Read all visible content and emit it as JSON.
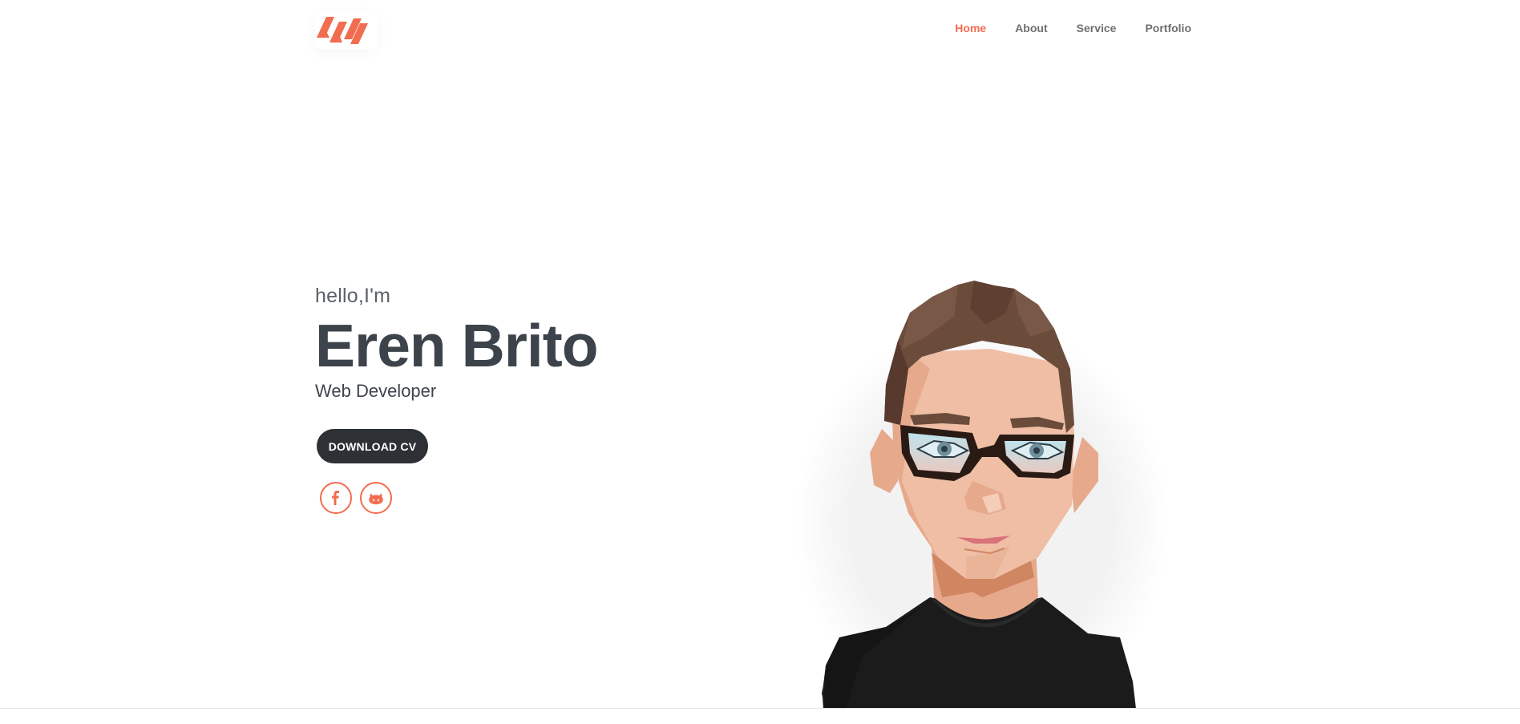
{
  "nav": {
    "items": [
      {
        "label": "Home",
        "active": true
      },
      {
        "label": "About",
        "active": false
      },
      {
        "label": "Service",
        "active": false
      },
      {
        "label": "Portfolio",
        "active": false
      }
    ]
  },
  "hero": {
    "greeting": "hello,I'm",
    "name": "Eren Brito",
    "role": "Web Developer",
    "cv_button": "DOWNLOAD CV"
  },
  "social": {
    "items": [
      {
        "icon": "facebook-icon"
      },
      {
        "icon": "github-icon"
      }
    ]
  },
  "colors": {
    "accent": "#f26c4f",
    "text_dark": "#3d434b",
    "button_bg": "#2d3035",
    "nav_text": "#6f6f6f"
  }
}
